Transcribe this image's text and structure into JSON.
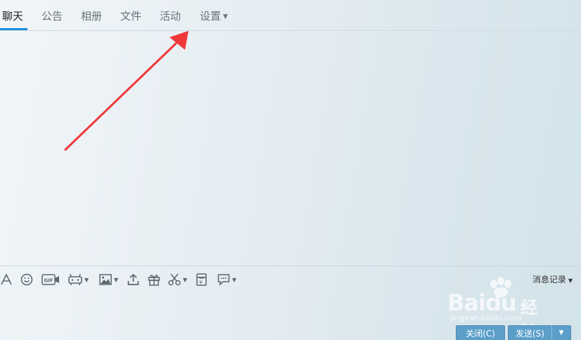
{
  "tabs": [
    {
      "label": "聊天",
      "active": true
    },
    {
      "label": "公告",
      "active": false
    },
    {
      "label": "相册",
      "active": false
    },
    {
      "label": "文件",
      "active": false
    },
    {
      "label": "活动",
      "active": false
    },
    {
      "label": "设置",
      "active": false,
      "has_dropdown": true
    }
  ],
  "toolbar": {
    "icons": [
      "font-icon",
      "emoji-icon",
      "gif-icon",
      "magic-expression-icon",
      "image-icon",
      "upload-icon",
      "gift-icon",
      "scissors-icon",
      "red-packet-icon",
      "chat-bubble-icon"
    ],
    "history_label": "消息记录"
  },
  "buttons": {
    "close_label": "关闭(C)",
    "send_label": "发送(S)"
  },
  "watermark": {
    "brand": "Baidu",
    "cn": "经验",
    "sub": "jingyan.baidu.com"
  },
  "colors": {
    "accent": "#1c8fd6",
    "button": "#5b9fc9",
    "arrow": "#f0383a"
  }
}
